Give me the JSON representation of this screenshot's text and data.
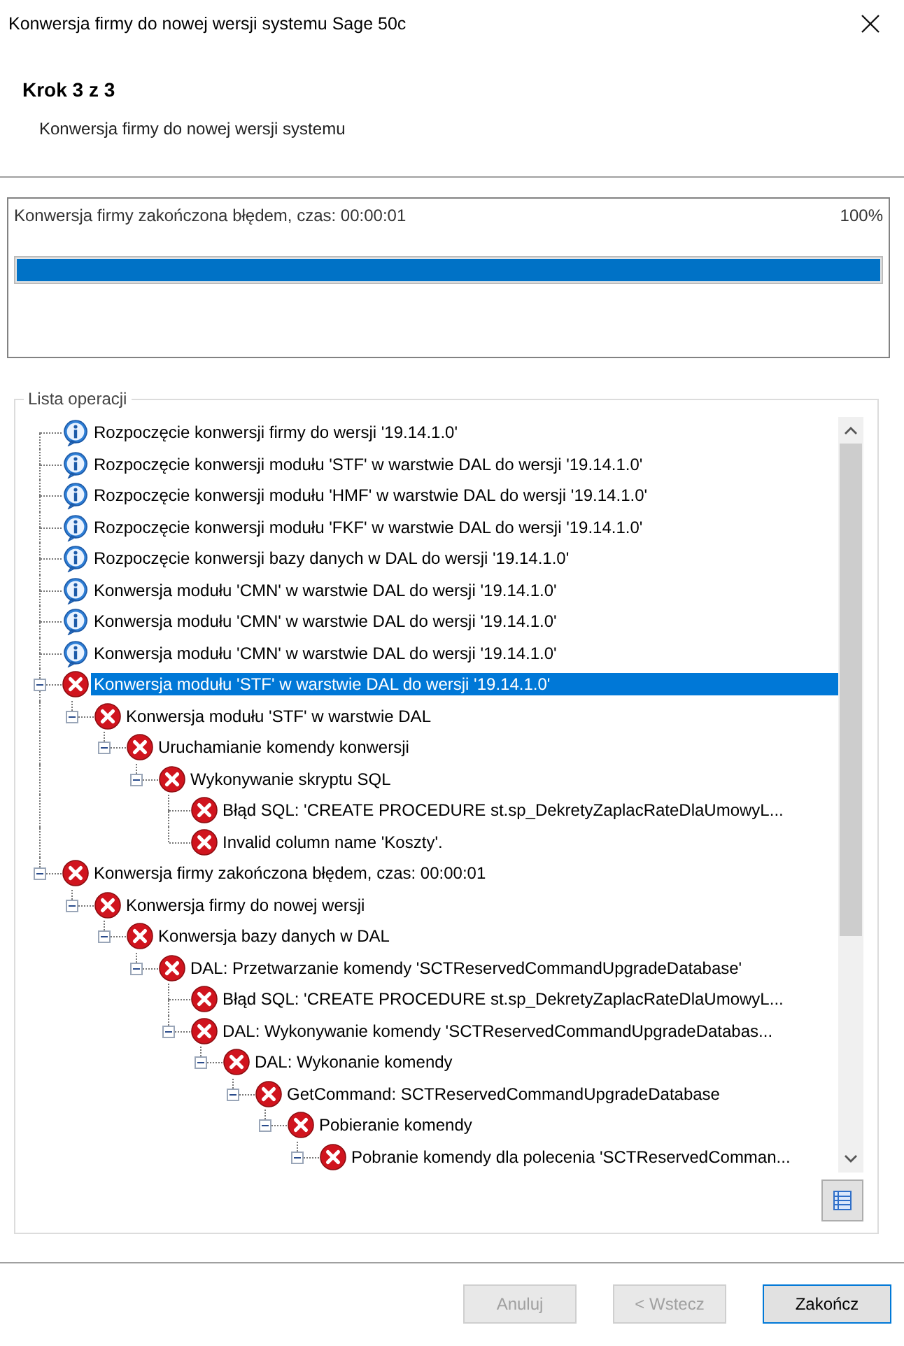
{
  "window": {
    "title": "Konwersja firmy do nowej wersji systemu Sage 50c"
  },
  "header": {
    "step": "Krok 3 z 3",
    "subtitle": "Konwersja firmy do nowej wersji systemu"
  },
  "progress": {
    "status": "Konwersja firmy zakończona błędem, czas: 00:00:01",
    "percent": "100%",
    "level": 1
  },
  "operations": {
    "title": "Lista operacji",
    "items": [
      {
        "kind": "info",
        "text": "Rozpoczęcie konwersji firmy do wersji '19.14.1.0'",
        "selected": false
      },
      {
        "kind": "info",
        "text": "Rozpoczęcie konwersji modułu 'STF' w warstwie DAL do wersji '19.14.1.0'",
        "selected": false
      },
      {
        "kind": "info",
        "text": "Rozpoczęcie konwersji modułu 'HMF' w warstwie DAL do wersji '19.14.1.0'",
        "selected": false
      },
      {
        "kind": "info",
        "text": "Rozpoczęcie konwersji modułu 'FKF' w warstwie DAL do wersji '19.14.1.0'",
        "selected": false
      },
      {
        "kind": "info",
        "text": "Rozpoczęcie konwersji bazy danych w DAL do wersji '19.14.1.0'",
        "selected": false
      },
      {
        "kind": "info",
        "text": "Konwersja modułu 'CMN' w warstwie DAL do wersji '19.14.1.0'",
        "selected": false
      },
      {
        "kind": "info",
        "text": "Konwersja modułu 'CMN' w warstwie DAL do wersji '19.14.1.0'",
        "selected": false
      },
      {
        "kind": "info",
        "text": "Konwersja modułu 'CMN' w warstwie DAL do wersji '19.14.1.0'",
        "selected": false
      },
      {
        "kind": "error",
        "text": "Konwersja modułu 'STF' w warstwie DAL do wersji '19.14.1.0'",
        "selected": true,
        "expanded": true,
        "children": [
          {
            "kind": "error",
            "text": "Konwersja modułu 'STF' w warstwie DAL",
            "selected": false,
            "expanded": true,
            "children": [
              {
                "kind": "error",
                "text": "Uruchamianie komendy konwersji",
                "selected": false,
                "expanded": true,
                "children": [
                  {
                    "kind": "error",
                    "text": "Wykonywanie skryptu SQL",
                    "selected": false,
                    "expanded": true,
                    "children": [
                      {
                        "kind": "error",
                        "text": "Błąd SQL: 'CREATE PROCEDURE st.sp_DekretyZaplacRateDlaUmowyL...",
                        "selected": false
                      },
                      {
                        "kind": "error",
                        "text": "Invalid column name 'Koszty'.",
                        "selected": false
                      }
                    ]
                  }
                ]
              }
            ]
          }
        ]
      },
      {
        "kind": "error",
        "text": "Konwersja firmy zakończona błędem, czas: 00:00:01",
        "selected": false,
        "expanded": true,
        "children": [
          {
            "kind": "error",
            "text": "Konwersja firmy do nowej wersji",
            "selected": false,
            "expanded": true,
            "children": [
              {
                "kind": "error",
                "text": "Konwersja bazy danych w DAL",
                "selected": false,
                "expanded": true,
                "children": [
                  {
                    "kind": "error",
                    "text": "DAL: Przetwarzanie komendy 'SCTReservedCommandUpgradeDatabase'",
                    "selected": false,
                    "expanded": true,
                    "children": [
                      {
                        "kind": "error",
                        "text": "Błąd SQL: 'CREATE PROCEDURE st.sp_DekretyZaplacRateDlaUmowyL...",
                        "selected": false
                      },
                      {
                        "kind": "error",
                        "text": "DAL: Wykonywanie komendy 'SCTReservedCommandUpgradeDatabas...",
                        "selected": false,
                        "expanded": true,
                        "children": [
                          {
                            "kind": "error",
                            "text": "DAL: Wykonanie komendy",
                            "selected": false,
                            "expanded": true,
                            "children": [
                              {
                                "kind": "error",
                                "text": "GetCommand: SCTReservedCommandUpgradeDatabase",
                                "selected": false,
                                "expanded": true,
                                "children": [
                                  {
                                    "kind": "error",
                                    "text": "Pobieranie komendy",
                                    "selected": false,
                                    "expanded": true,
                                    "children": [
                                      {
                                        "kind": "error",
                                        "text": "Pobranie komendy dla polecenia 'SCTReservedComman...",
                                        "selected": false,
                                        "expanded": true
                                      }
                                    ]
                                  }
                                ]
                              }
                            ]
                          }
                        ]
                      }
                    ]
                  }
                ]
              }
            ]
          }
        ]
      }
    ]
  },
  "buttons": [
    {
      "label": "Anuluj",
      "disabled": true
    },
    {
      "label": "< Wstecz",
      "disabled": true
    },
    {
      "label": "Zakończ",
      "disabled": false
    }
  ]
}
